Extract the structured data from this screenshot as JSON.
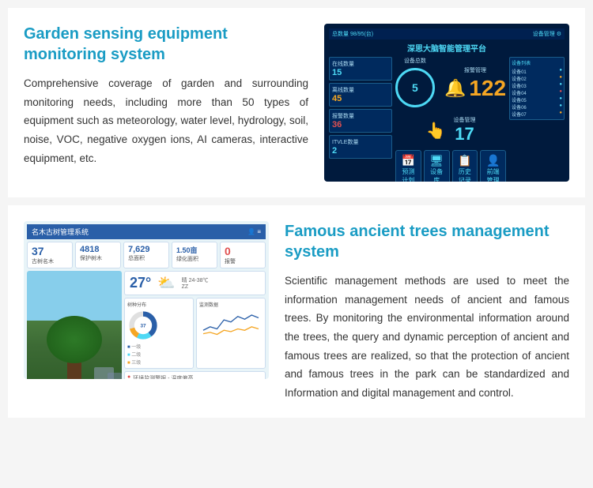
{
  "section1": {
    "title": "Garden sensing equipment monitoring system",
    "description": "Comprehensive coverage of garden and surrounding monitoring needs, including more than 50 types of equipment such as meteorology, water level, hydrology, soil, noise, VOC, negative oxygen ions, AI cameras, interactive equipment, etc.",
    "dashboard": {
      "title": "深思大脑智能管理平台",
      "top_label": "总数量 98/95(台)",
      "big_number1": "122",
      "big_number2": "17",
      "circle_number": "5",
      "stats": [
        "15",
        "45",
        "36",
        "2"
      ],
      "stat_labels": [
        "在线数量",
        "离线数量",
        "报警数量",
        "ITVLE数量"
      ],
      "icons": [
        "📅",
        "🖥",
        "📋",
        "👤"
      ],
      "icon_labels": [
        "预测计划",
        "设备库",
        "历史记录",
        "前端管理"
      ]
    }
  },
  "section2": {
    "title": "Famous ancient trees management system",
    "description": "Scientific management methods are used to meet the information management needs of ancient and famous trees. By monitoring the environmental information around the trees, the query and dynamic perception of ancient and famous trees are realized, so that the protection of ancient and famous trees in the park can be standardized and Information and digital management and control.",
    "dashboard": {
      "title": "名木古树管理系统",
      "stats": [
        {
          "num": "37",
          "label": "古树名木"
        },
        {
          "num": "4818",
          "label": "保护树木"
        },
        {
          "num": "7,629",
          "label": "总面积"
        },
        {
          "num": "1.50亩",
          "label": "绿化面积"
        },
        {
          "num": "0",
          "label": "报警"
        }
      ],
      "temperature": "27°",
      "weather": "晴 24-38℃ ZZ"
    }
  }
}
